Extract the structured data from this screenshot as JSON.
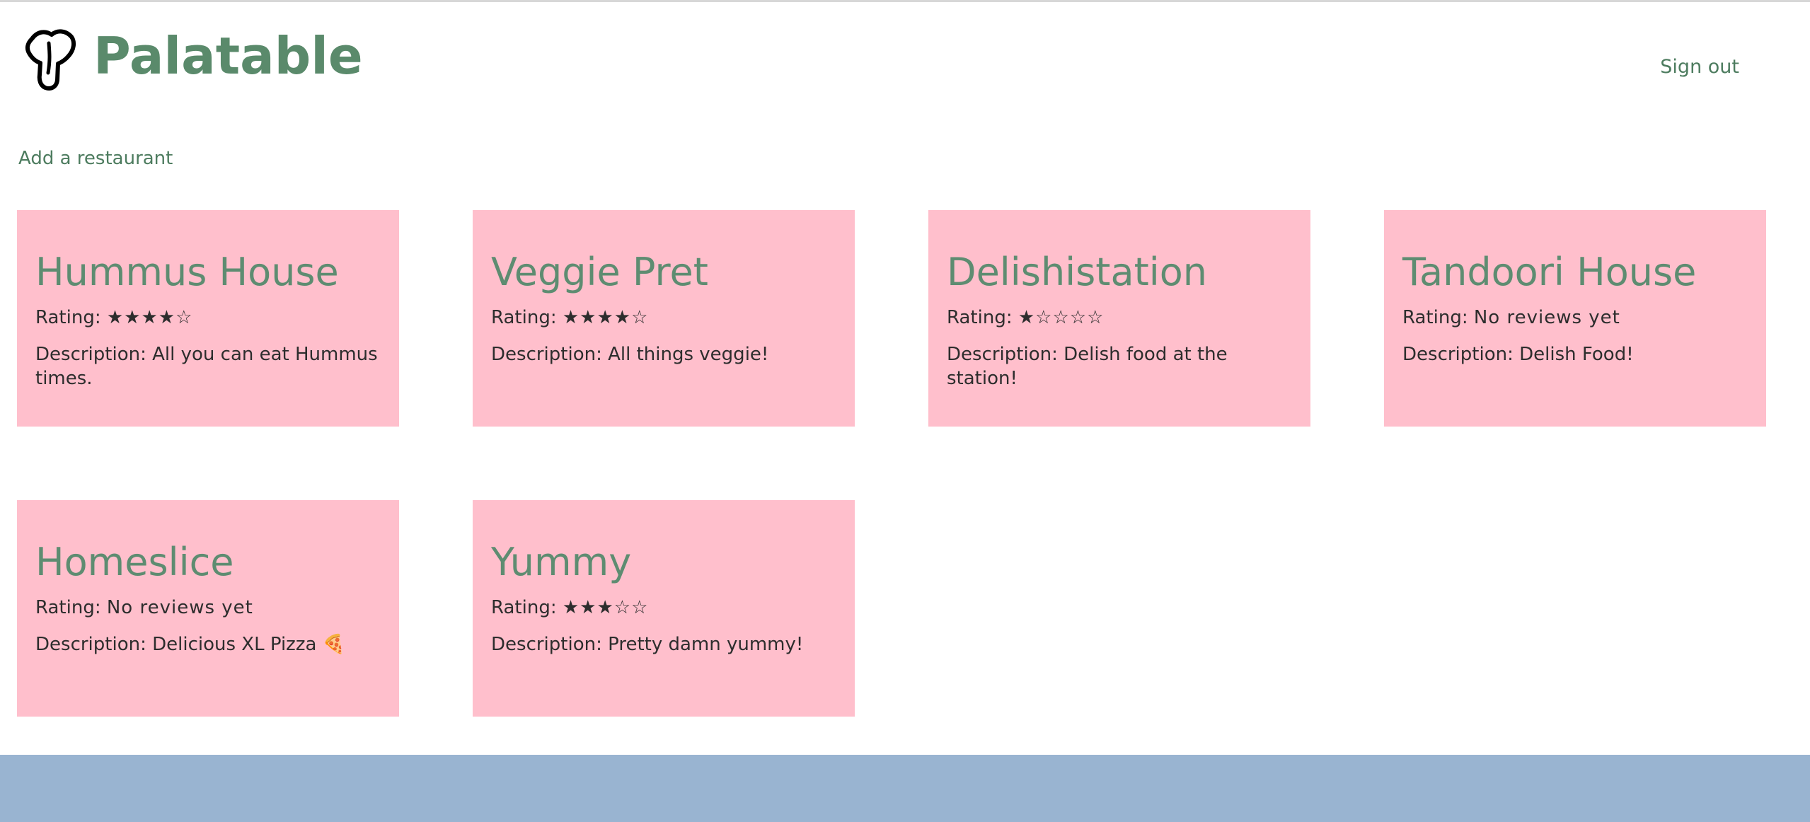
{
  "header": {
    "brand": "Palatable",
    "sign_out": "Sign out"
  },
  "actions": {
    "add_restaurant": "Add a restaurant"
  },
  "restaurants": [
    {
      "name": "Hummus House",
      "rating_label": "Rating:",
      "rating": "★★★★☆",
      "description_label": "Description:",
      "description": "All you can eat Hummus times."
    },
    {
      "name": "Veggie Pret",
      "rating_label": "Rating:",
      "rating": "★★★★☆",
      "description_label": "Description:",
      "description": "All things veggie!"
    },
    {
      "name": "Delishistation",
      "rating_label": "Rating:",
      "rating": "★☆☆☆☆",
      "description_label": "Description:",
      "description": "Delish food at the station!"
    },
    {
      "name": "Tandoori House",
      "rating_label": "Rating:",
      "rating": "No reviews yet",
      "description_label": "Description:",
      "description": "Delish Food!"
    },
    {
      "name": "Homeslice",
      "rating_label": "Rating:",
      "rating": "No reviews yet",
      "description_label": "Description:",
      "description": "Delicious XL Pizza 🍕"
    },
    {
      "name": "Yummy",
      "rating_label": "Rating:",
      "rating": "★★★☆☆",
      "description_label": "Description:",
      "description": "Pretty damn yummy!"
    }
  ],
  "colors": {
    "brand": "#5a8a6b",
    "card_background": "#ffbfcc",
    "footer": "#99b4d1"
  },
  "icons": {
    "logo": "tongue-logo-icon"
  }
}
